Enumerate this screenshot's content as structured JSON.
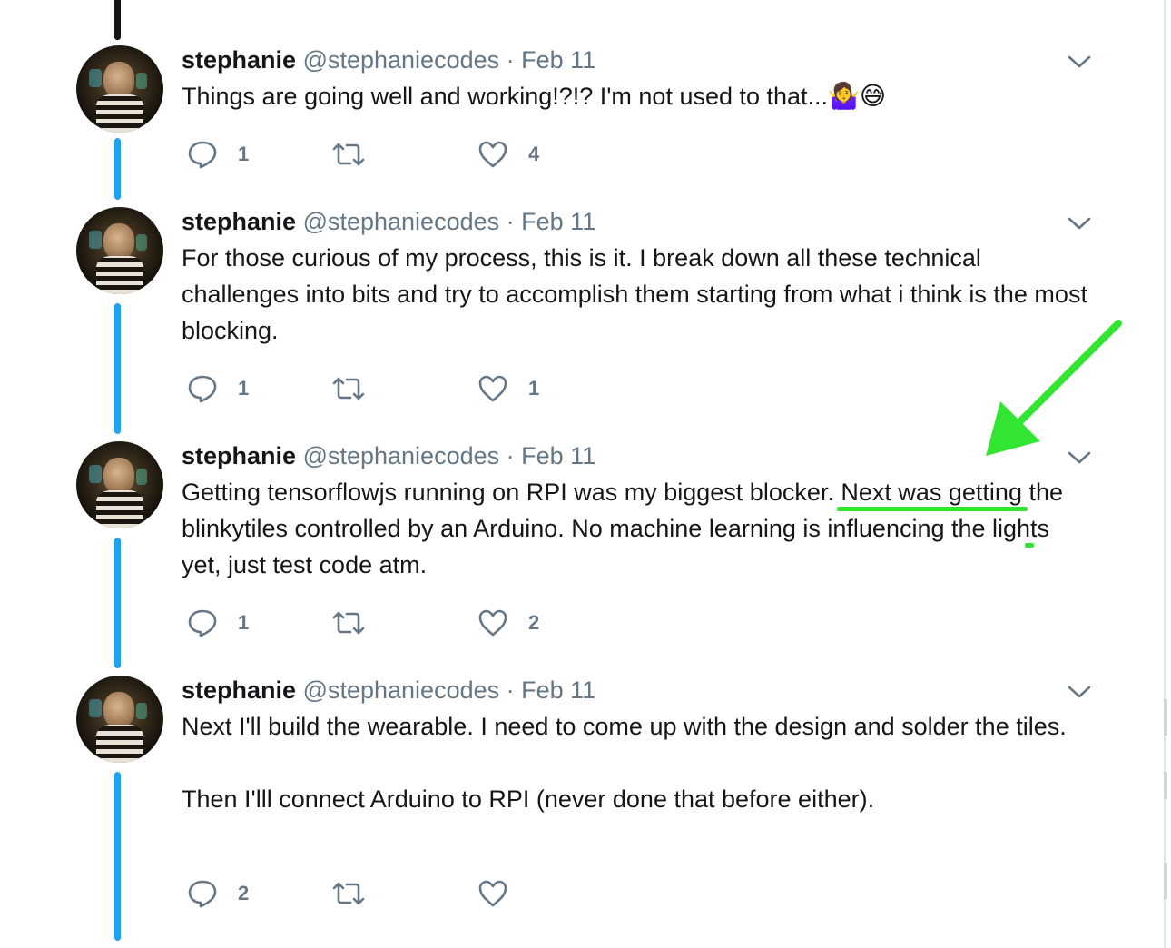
{
  "tweets": [
    {
      "name": "stephanie",
      "handle": "@stephaniecodes",
      "date": "Feb 11",
      "text": "Things are going well and working!?!? I'm not used to that...",
      "emojis": "🤷‍♀️😅",
      "replies": "1",
      "retweets": "",
      "likes": "4"
    },
    {
      "name": "stephanie",
      "handle": "@stephaniecodes",
      "date": "Feb 11",
      "text": "For those curious of my process, this is it. I break down all these technical challenges into bits and try to accomplish them starting from what i think is the most blocking.",
      "replies": "1",
      "retweets": "",
      "likes": "1"
    },
    {
      "name": "stephanie",
      "handle": "@stephaniecodes",
      "date": "Feb 11",
      "text_before": "Getting tensorflowjs running on RPI was my biggest blocker. ",
      "text_highlight_1": "Next was getting",
      "text_highlight_2": "the blinkytiles controlled by an Arduino.",
      "text_after": " No machine learning is influencing the lights yet, just test code atm.",
      "replies": "1",
      "retweets": "",
      "likes": "2"
    },
    {
      "name": "stephanie",
      "handle": "@stephaniecodes",
      "date": "Feb 11",
      "text": "Next I'll build the wearable. I need to come up with the design and solder the tiles.\n\nThen I'lll connect Arduino to RPI (never done that before either).",
      "replies": "2",
      "retweets": "",
      "likes": ""
    }
  ],
  "icons": {
    "reply": "reply-icon",
    "retweet": "retweet-icon",
    "like": "heart-icon",
    "more": "chevron-down-icon",
    "annotation": "green-arrow-icon"
  },
  "colors": {
    "thread_line": "#1da1f2",
    "muted": "#657786",
    "annotation_green": "#33e533"
  }
}
